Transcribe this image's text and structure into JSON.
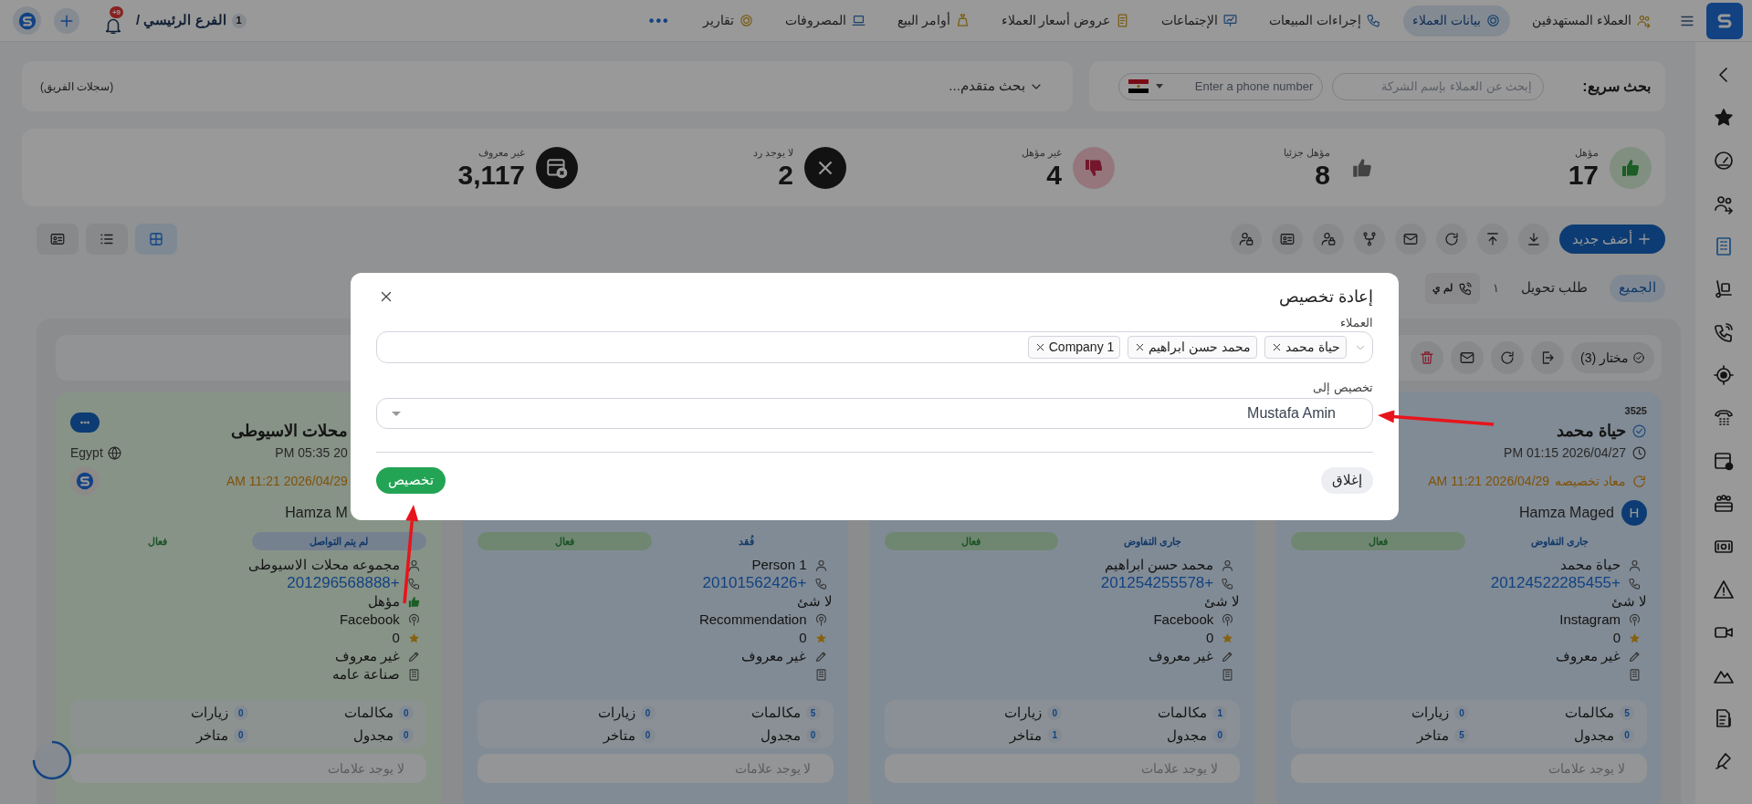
{
  "top_nav": {
    "items": [
      {
        "label": "العملاء المستهدفين",
        "selected": false
      },
      {
        "label": "بيانات العملاء",
        "selected": true
      },
      {
        "label": "إجراءات المبيعات",
        "selected": false
      },
      {
        "label": "الإجتماعات",
        "selected": false
      },
      {
        "label": "عروض أسعار العملاء",
        "selected": false
      },
      {
        "label": "أوامر البيع",
        "selected": false
      },
      {
        "label": "المصروفات",
        "selected": false
      },
      {
        "label": "تقارير",
        "selected": false
      }
    ],
    "more": "•••",
    "branch": "الفرع الرئيسي /",
    "branch_count": "1",
    "notifications": "+9"
  },
  "sidebar": {
    "items": [
      {
        "selected": false
      },
      {
        "selected": false
      },
      {
        "selected": false
      },
      {
        "selected": false
      },
      {
        "selected": true
      },
      {
        "selected": false
      },
      {
        "selected": false
      },
      {
        "selected": false
      },
      {
        "selected": false
      },
      {
        "selected": false
      },
      {
        "selected": false
      },
      {
        "selected": false
      },
      {
        "selected": false
      },
      {
        "selected": false
      },
      {
        "selected": false
      },
      {
        "selected": false
      },
      {
        "selected": false
      }
    ]
  },
  "quick_search": {
    "label": "بحث سريع:",
    "company_placeholder": "إبحث عن العملاء بإسم الشركة",
    "phone_placeholder": "Enter a phone number"
  },
  "advanced_search": {
    "label": "بحث متقدم...",
    "team_records": "(سجلات الفريق)"
  },
  "stats": [
    {
      "label": "مؤهل",
      "value": "17",
      "kind": "qualified"
    },
    {
      "label": "مؤهل جزئيا",
      "value": "8",
      "kind": "partial"
    },
    {
      "label": "غير مؤهل",
      "value": "4",
      "kind": "unqualified"
    },
    {
      "label": "لا يوجد رد",
      "value": "2",
      "kind": "no_reply"
    },
    {
      "label": "غير معروف",
      "value": "3,117",
      "kind": "unknown"
    }
  ],
  "toolbar": {
    "add_button": "أضف جديد",
    "views": [
      {
        "selected": true
      },
      {
        "selected": false
      },
      {
        "selected": false
      }
    ]
  },
  "filters": [
    {
      "label": "الجميع",
      "kind": "tab",
      "selected": true
    },
    {
      "label": "طلب تحويل",
      "kind": "tab",
      "count": "١",
      "selected": false
    },
    {
      "label": "لم ي",
      "kind": "chip"
    }
  ],
  "selection_bar": {
    "selected_count": "مختار (3)"
  },
  "cards": [
    {
      "selected": true,
      "id": "3525",
      "name": "حياة محمد",
      "verified": true,
      "date": "PM 01:15 2026/04/27",
      "reassigned_label": "معاد تخصيصه",
      "reassigned_date": "AM 11:21 2026/04/29",
      "owner": "Hamza Maged",
      "owner_initial": "H",
      "badges": [
        {
          "label": "جارى التفاوض",
          "kind": "stage",
          "filled": false
        },
        {
          "label": "فعال",
          "kind": "activity",
          "filled": true
        }
      ],
      "contact": "حياة محمد",
      "phone": "20124522285455+",
      "qualification": "لا شئ",
      "qualified": false,
      "source": "Instagram",
      "rating": "0",
      "note": "غير معروف",
      "stats": [
        {
          "label": "مكالمات",
          "value": "5"
        },
        {
          "label": "زيارات",
          "value": "0"
        },
        {
          "label": "مجدول",
          "value": "0"
        },
        {
          "label": "متاخر",
          "value": "5"
        }
      ],
      "tags": "لا يوجد علامات"
    },
    {
      "selected": true,
      "badges": [
        {
          "label": "جارى التفاوض",
          "kind": "stage",
          "filled": false
        },
        {
          "label": "فعال",
          "kind": "activity",
          "filled": true
        }
      ],
      "contact": "محمد حسن ابراهيم",
      "phone": "201254255578+",
      "qualification": "لا شئ",
      "qualified": false,
      "source": "Facebook",
      "rating": "0",
      "note": "غير معروف",
      "stats": [
        {
          "label": "مكالمات",
          "value": "1"
        },
        {
          "label": "زيارات",
          "value": "0"
        },
        {
          "label": "مجدول",
          "value": "0"
        },
        {
          "label": "متاخر",
          "value": "1"
        }
      ],
      "tags": "لا يوجد علامات"
    },
    {
      "selected": true,
      "badges": [
        {
          "label": "فُقد",
          "kind": "stage",
          "filled": false
        },
        {
          "label": "فعال",
          "kind": "activity",
          "filled": true
        }
      ],
      "contact": "Person 1",
      "phone": "20101562426+",
      "qualification": "لا شئ",
      "qualified": false,
      "source": "Recommendation",
      "rating": "0",
      "note": "غير معروف",
      "stats": [
        {
          "label": "مكالمات",
          "value": "5"
        },
        {
          "label": "زيارات",
          "value": "0"
        },
        {
          "label": "مجدول",
          "value": "0"
        },
        {
          "label": "متاخر",
          "value": "0"
        }
      ],
      "tags": "لا يوجد علامات"
    },
    {
      "selected": false,
      "name": "محلات الاسيوطى",
      "date": "PM 05:35 20",
      "reassigned_date": "AM 11:21 2026/04/29",
      "owner": "Hamza M",
      "country": "Egypt",
      "badges": [
        {
          "label": "لم يتم التواصل",
          "kind": "stage",
          "filled": true
        },
        {
          "label": "فعال",
          "kind": "activity",
          "filled": false
        }
      ],
      "contact": "مجموعه محلات الاسيوطى",
      "phone": "201296568888+",
      "qualification": "مؤهل",
      "qualified": true,
      "source": "Facebook",
      "rating": "0",
      "note": "غير معروف",
      "sector": "صناعة عامه",
      "stats": [
        {
          "label": "مكالمات",
          "value": "0"
        },
        {
          "label": "زيارات",
          "value": "0"
        },
        {
          "label": "مجدول",
          "value": "0"
        },
        {
          "label": "متاخر",
          "value": "0"
        }
      ],
      "tags": "لا يوجد علامات"
    }
  ],
  "modal": {
    "title": "إعادة تخصيص",
    "customers_label": "العملاء",
    "customers": [
      "حياة محمد",
      "محمد حسن ابراهيم",
      "Company 1"
    ],
    "assign_label": "تخصيص إلى",
    "assign_value": "Mustafa Amin",
    "close_button": "إغلاق",
    "submit_button": "تخصيص"
  }
}
